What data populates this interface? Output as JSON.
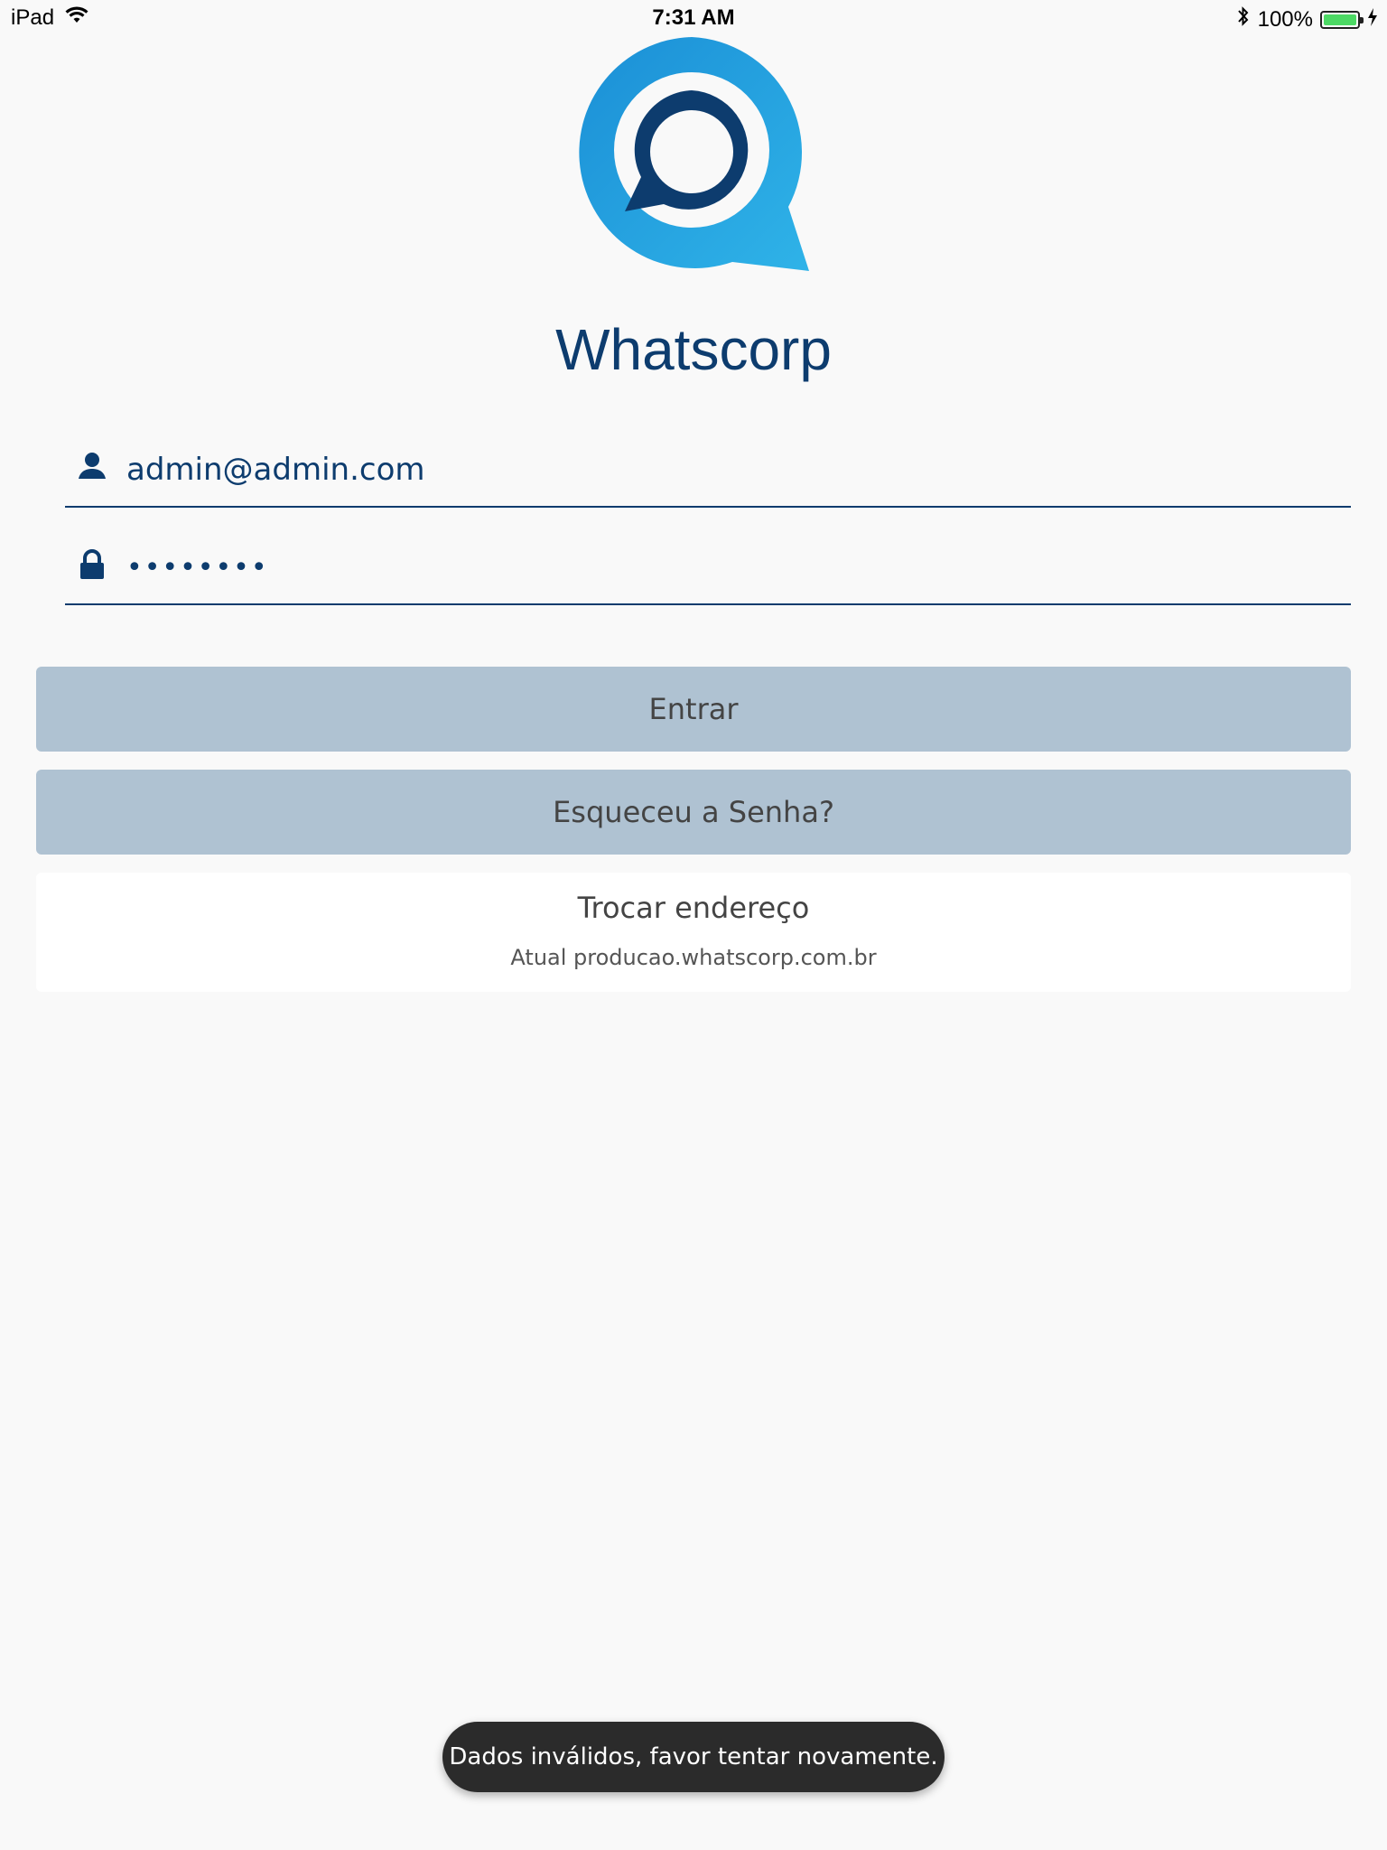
{
  "status_bar": {
    "device": "iPad",
    "time": "7:31 AM",
    "battery_percent": "100%",
    "battery_level": 1.0,
    "icons": [
      "wifi-icon",
      "bluetooth-icon",
      "battery-icon",
      "charging-icon"
    ]
  },
  "app": {
    "title": "Whatscorp",
    "logo_icon": "whatscorp-logo-icon",
    "colors": {
      "brand_dark": "#0d3c6e",
      "brand_light": "#29a9e1",
      "button_bg": "#afc2d2"
    }
  },
  "login": {
    "email": {
      "icon": "user-icon",
      "value": "admin@admin.com"
    },
    "password": {
      "icon": "lock-icon",
      "value": "••••••••"
    },
    "login_button": "Entrar",
    "forgot_button": "Esqueceu a Senha?",
    "change_address": {
      "title": "Trocar endereço",
      "current": "Atual producao.whatscorp.com.br"
    }
  },
  "toast": {
    "message": "Dados inválidos, favor tentar novamente."
  }
}
